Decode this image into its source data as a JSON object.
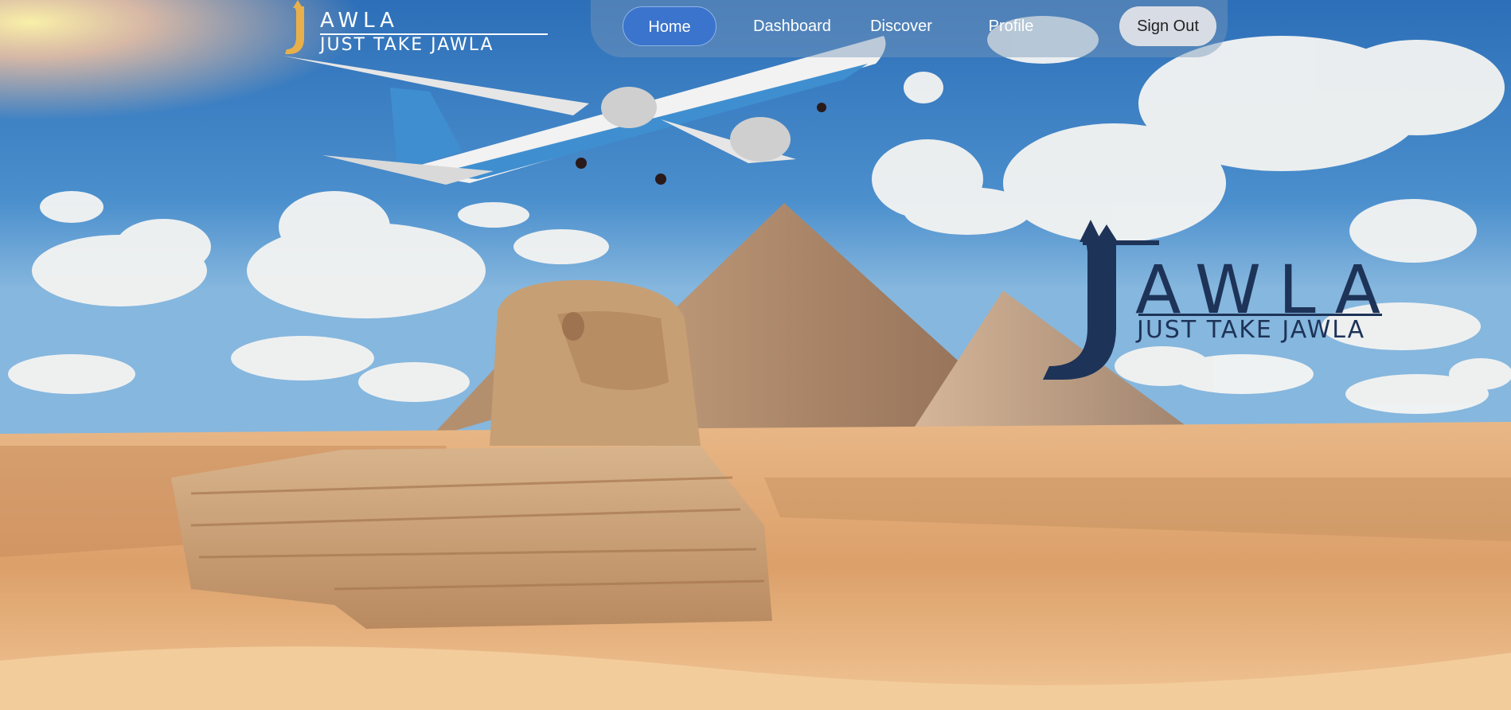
{
  "brand": {
    "name": "AWLA",
    "tagline": "JUST TAKE JAWLA",
    "hero_name": "AWLA",
    "hero_tagline": "JUST TAKE JAWLA",
    "color_dark": "#1e3358",
    "color_gold": "#e8b04a"
  },
  "nav": {
    "items": [
      {
        "label": "Home",
        "active": true
      },
      {
        "label": "Dashboard"
      },
      {
        "label": "Discover"
      },
      {
        "label": "Profile"
      }
    ],
    "signout_label": "Sign Out",
    "accent": "#3b74cc"
  },
  "icons": {
    "logo_glyph": "j-logo-icon"
  }
}
